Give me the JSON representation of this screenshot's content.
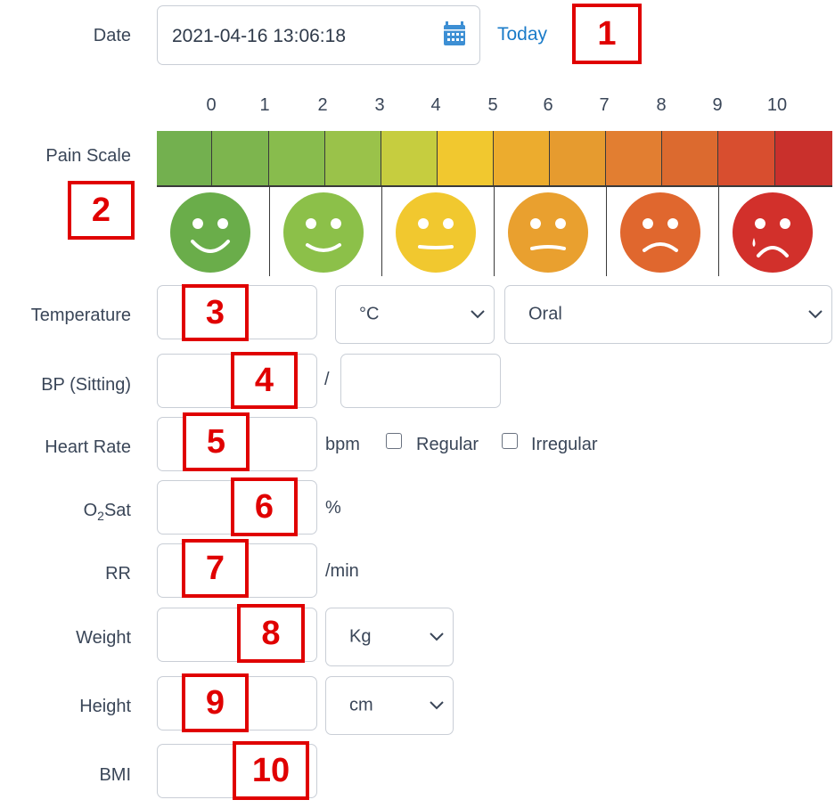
{
  "date": {
    "label": "Date",
    "value": "2021-04-16 13:06:18",
    "today_link": "Today"
  },
  "pain_scale": {
    "label": "Pain Scale",
    "ticks": [
      "0",
      "1",
      "2",
      "3",
      "4",
      "5",
      "6",
      "7",
      "8",
      "9",
      "10"
    ],
    "colors": [
      "#73b04f",
      "#7db54e",
      "#88bc4d",
      "#9ac24a",
      "#c6cd3f",
      "#f1c82f",
      "#ecac2e",
      "#e69b2f",
      "#e27e31",
      "#dc6a2f",
      "#d84e2f",
      "#c9302c"
    ],
    "faces": [
      {
        "name": "smile-face-icon",
        "color": "#6aad4a"
      },
      {
        "name": "smile-face-icon",
        "color": "#8cc049"
      },
      {
        "name": "neutral-face-icon",
        "color": "#f1c82f"
      },
      {
        "name": "slight-frown-face-icon",
        "color": "#e9a02f"
      },
      {
        "name": "frown-face-icon",
        "color": "#e0672e"
      },
      {
        "name": "crying-face-icon",
        "color": "#d2302b"
      }
    ]
  },
  "temperature": {
    "label": "Temperature",
    "unit": "°C",
    "site": "Oral"
  },
  "bp": {
    "label": "BP (Sitting)",
    "separator": "/"
  },
  "heart_rate": {
    "label": "Heart Rate",
    "unit": "bpm",
    "regular": "Regular",
    "irregular": "Irregular"
  },
  "o2sat": {
    "label_main": "O",
    "label_sub": "2",
    "label_tail": "Sat",
    "unit": "%"
  },
  "rr": {
    "label": "RR",
    "unit": "/min"
  },
  "weight": {
    "label": "Weight",
    "unit": "Kg"
  },
  "height": {
    "label": "Height",
    "unit": "cm"
  },
  "bmi": {
    "label": "BMI"
  },
  "annotations": [
    "1",
    "2",
    "3",
    "4",
    "5",
    "6",
    "7",
    "8",
    "9",
    "10"
  ],
  "accent_color": "#1a7bc8",
  "annotation_color": "#e00000"
}
